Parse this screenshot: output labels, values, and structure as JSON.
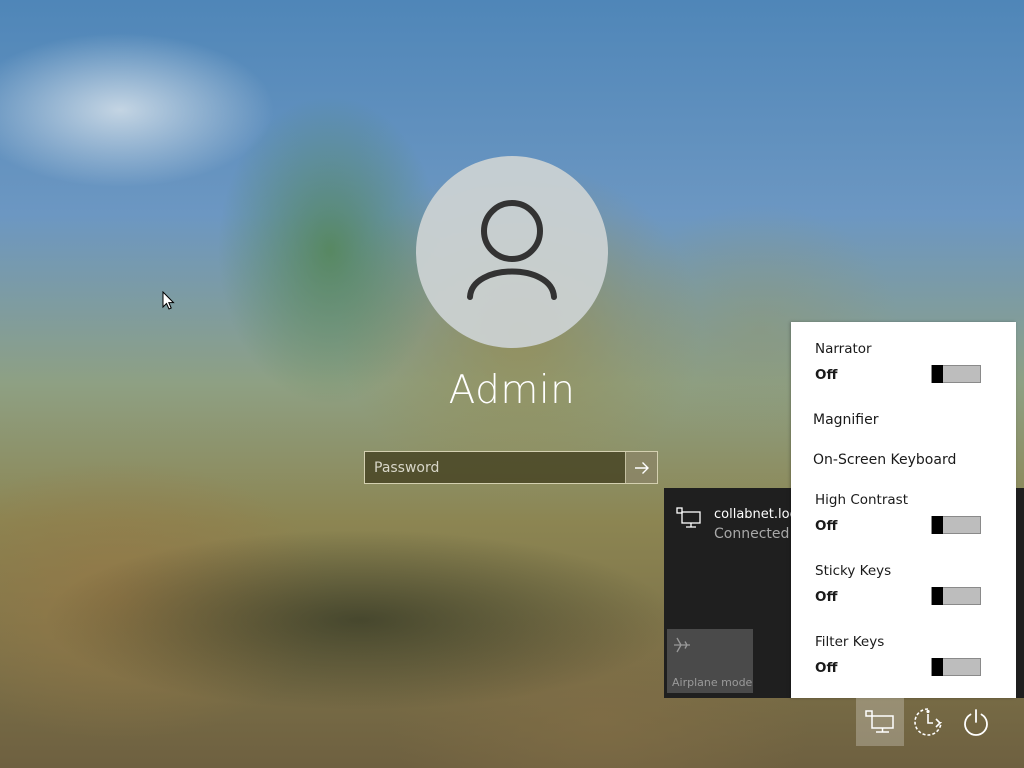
{
  "account": {
    "username": "Admin",
    "password_placeholder": "Password",
    "avatar_icon": "user-icon",
    "submit_icon": "arrow-right-icon"
  },
  "network_flyout": {
    "network_name": "collabnet.local",
    "network_status": "Connected",
    "network_icon": "ethernet-icon",
    "airplane_label": "Airplane mode",
    "airplane_icon": "airplane-icon"
  },
  "ease_of_access": {
    "narrator": {
      "label": "Narrator",
      "state": "Off",
      "on": false
    },
    "magnifier": {
      "label": "Magnifier"
    },
    "on_screen_keyboard": {
      "label": "On-Screen Keyboard"
    },
    "high_contrast": {
      "label": "High Contrast",
      "state": "Off",
      "on": false
    },
    "sticky_keys": {
      "label": "Sticky Keys",
      "state": "Off",
      "on": false
    },
    "filter_keys": {
      "label": "Filter Keys",
      "state": "Off",
      "on": false
    }
  },
  "corner_buttons": {
    "network": "network-icon",
    "ease_of_access": "ease-of-access-icon",
    "power": "power-icon"
  },
  "colors": {
    "panel_background": "#ffffff",
    "flyout_background": "#1f1f1f",
    "toggle_knob": "#000000",
    "toggle_track": "#bdbdbd"
  }
}
